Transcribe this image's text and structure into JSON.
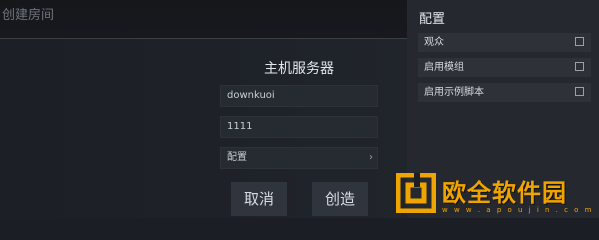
{
  "header": {
    "title": "创建房间"
  },
  "server": {
    "title": "主机服务器",
    "hostname_value": "downkuoi",
    "port_value": "1111",
    "config_label": "配置",
    "config_chevron": "›"
  },
  "buttons": {
    "cancel_label": "取消",
    "create_label": "创造"
  },
  "sidebar": {
    "title": "配置",
    "options": [
      {
        "label": "观众",
        "checked": false
      },
      {
        "label": "启用模组",
        "checked": false
      },
      {
        "label": "启用示例脚本",
        "checked": false
      }
    ]
  },
  "watermark": {
    "name": "欧全软件园",
    "url": "w w w . a p o u j i n . c o m"
  },
  "colors": {
    "accent": "#f0a400",
    "panel": "#25282e",
    "background": "#1b1e24"
  }
}
